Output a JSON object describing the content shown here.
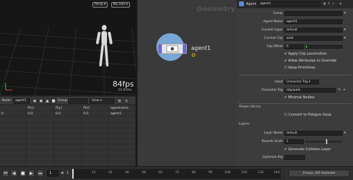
{
  "viewport": {
    "camera_dropdown": "Persp",
    "cam_dropdown": "No cam",
    "fps": "84fps",
    "frame_time": "11.97ms"
  },
  "spreadsheet": {
    "node_label": "Node:",
    "node_value": "agent1",
    "group_label": "Group:",
    "view_label": "View",
    "columns": [
      "",
      "P[x]",
      "P[y]",
      "P[z]",
      "agentname"
    ],
    "rows": [
      [
        "0",
        "0.0",
        "0.0",
        "0.0",
        "agent1"
      ]
    ]
  },
  "network": {
    "context_label": "Geometry",
    "node_name": "agent1"
  },
  "params": {
    "node_type": "Agent",
    "node_name": "agent1",
    "rows": [
      {
        "label": "Group",
        "value": ""
      },
      {
        "label": "Agent Name",
        "value": "agent1"
      },
      {
        "label": "Current Layer",
        "value": "default"
      },
      {
        "label": "Current Clip",
        "value": "walk"
      },
      {
        "label": "Clip Offset",
        "value": "0"
      }
    ],
    "checkboxes": [
      "Apply Clip Locomotion",
      "Allow Attributes to Override",
      "Keep Primitives"
    ],
    "input_label": "Input",
    "input_value": "Character Rig",
    "character_rig_label": "Character Rig",
    "character_rig_value": "/obj/walk",
    "convert_label": "Convert to Polygon Soup",
    "shape_library": "Shape Library",
    "layers": "Layers",
    "layer_name_label": "Layer Name",
    "layer_name_value": "default",
    "bounds_scale_label": "Bounds Scale",
    "bounds_scale_value": "1",
    "collision_label": "Generate Collision Layer",
    "optimize_label": "Optimize Rig",
    "accent_color": "#39b54a"
  },
  "timeline": {
    "frame": "1",
    "start": "1",
    "ticks": [
      "12",
      "24",
      "36",
      "48",
      "60",
      "72",
      "84",
      "96",
      "108",
      "120",
      "132",
      "144"
    ],
    "keys_label": "0 keys, 0/0 channels"
  }
}
